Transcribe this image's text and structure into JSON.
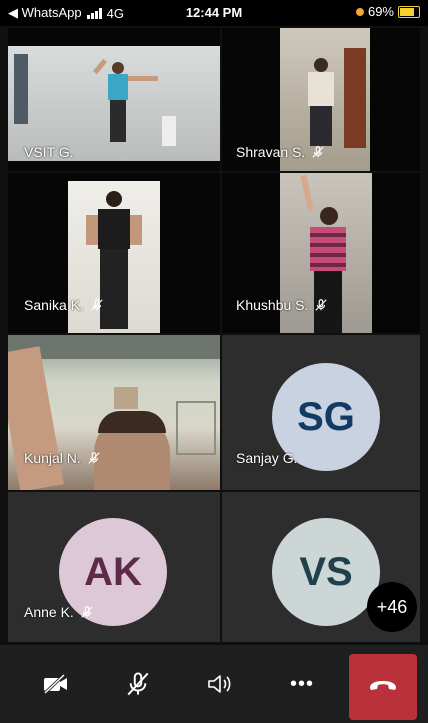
{
  "status_bar": {
    "back_app": "◀ WhatsApp",
    "network": "4G",
    "time": "12:44 PM",
    "battery_percent": "69%"
  },
  "participants": [
    {
      "name": "VSIT G.",
      "muted": false
    },
    {
      "name": "Shravan S.",
      "muted": true
    },
    {
      "name": "Sanika K.",
      "muted": true
    },
    {
      "name": "Khushbu S.",
      "muted": true
    },
    {
      "name": "Kunjal N.",
      "muted": true
    },
    {
      "name": "Sanjay G.",
      "initials": "SG",
      "avatar_color": "#c8d2e1",
      "text_color": "#123a63"
    },
    {
      "name": "Anne K.",
      "initials": "AK",
      "avatar_color": "#dcc8d7",
      "text_color": "#5d2b47",
      "muted": true
    },
    {
      "initials": "VS",
      "avatar_color": "#cdd6d6",
      "text_color": "#20404c"
    }
  ],
  "overflow_count": "+46",
  "controls": {
    "camera": "camera-off-icon",
    "mic": "mic-off-icon",
    "speaker": "speaker-icon",
    "more": "•••",
    "end_call_color": "#b8313b"
  }
}
